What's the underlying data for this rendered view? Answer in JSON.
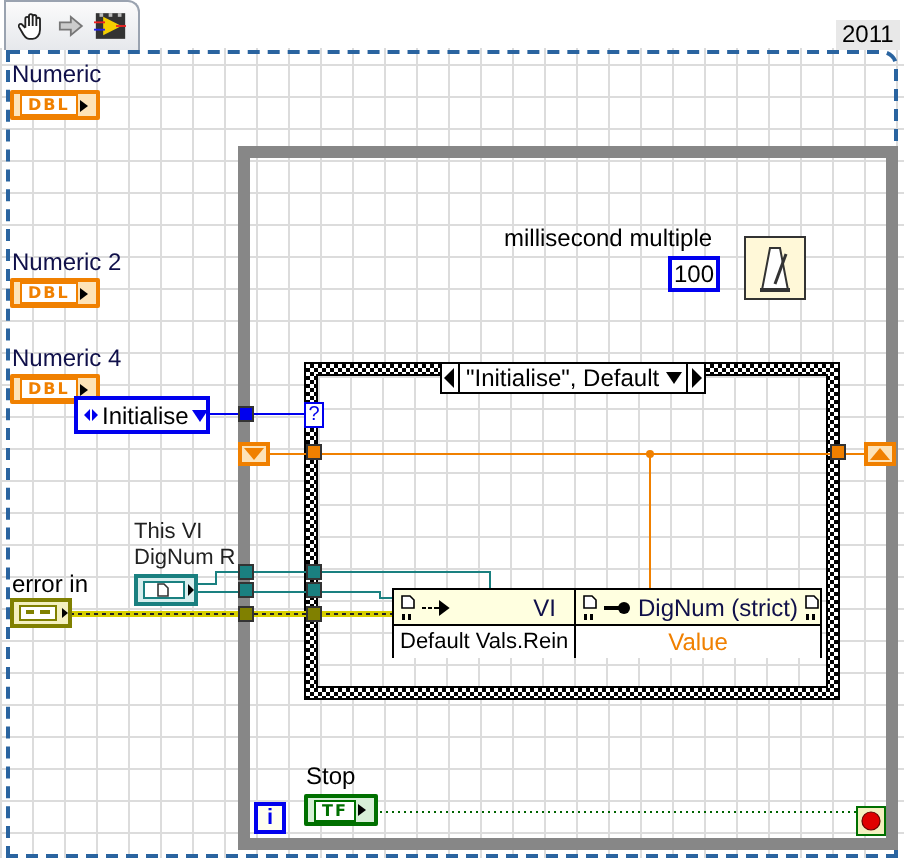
{
  "toolbar": {
    "version": "2011"
  },
  "controls": [
    {
      "label": "Numeric",
      "type": "DBL"
    },
    {
      "label": "Numeric 2",
      "type": "DBL"
    },
    {
      "label": "Numeric 4",
      "type": "DBL"
    }
  ],
  "enum_constant": {
    "value": "Initialise"
  },
  "wait": {
    "label": "millisecond multiple",
    "constant": "100"
  },
  "case_structure": {
    "selector": "\"Initialise\", Default",
    "selector_terminal": "?"
  },
  "error_in": {
    "label": "error in"
  },
  "reference": {
    "labels": [
      "This VI",
      "DigNum R"
    ]
  },
  "property_nodes": [
    {
      "class": "VI",
      "property": "Default Vals.Rein"
    },
    {
      "class": "DigNum (strict)",
      "property": "Value"
    }
  ],
  "stop": {
    "label": "Stop",
    "type": "TF"
  },
  "iteration_terminal": "i"
}
